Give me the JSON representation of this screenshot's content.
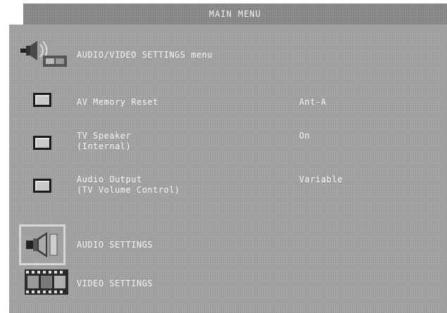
{
  "window": {
    "title": "MAIN MENU"
  },
  "header": {
    "label": "AUDIO/VIDEO SETTINGS menu",
    "icon": "speaker-film-icon"
  },
  "options": [
    {
      "label": "AV Memory Reset",
      "value": "Ant-A"
    },
    {
      "label": "TV Speaker\n(Internal)",
      "value": "On"
    },
    {
      "label": "Audio Output\n(TV Volume Control)",
      "value": "Variable"
    }
  ],
  "submenus": [
    {
      "label": "AUDIO SETTINGS",
      "icon": "speaker-icon",
      "selected": true
    },
    {
      "label": "VIDEO SETTINGS",
      "icon": "film-strip-icon",
      "selected": false
    }
  ],
  "colors": {
    "panel": "#a3a3a3",
    "title_bar": "#8c8c8c",
    "text": "#f4f4f4"
  }
}
